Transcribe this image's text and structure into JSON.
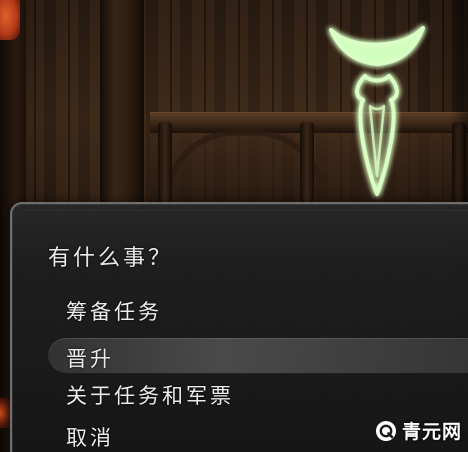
{
  "dialog": {
    "prompt": "有什么事？",
    "options": [
      {
        "label": "筹备任务",
        "selected": false
      },
      {
        "label": "晋升",
        "selected": true
      },
      {
        "label": "关于任务和军票",
        "selected": false
      },
      {
        "label": "取消",
        "selected": false
      }
    ]
  },
  "watermark": {
    "text": "青元网",
    "icon": "q-logo-icon"
  },
  "marker": {
    "icon": "quest-marker-icon",
    "glow_color": "#b8ffa0"
  }
}
